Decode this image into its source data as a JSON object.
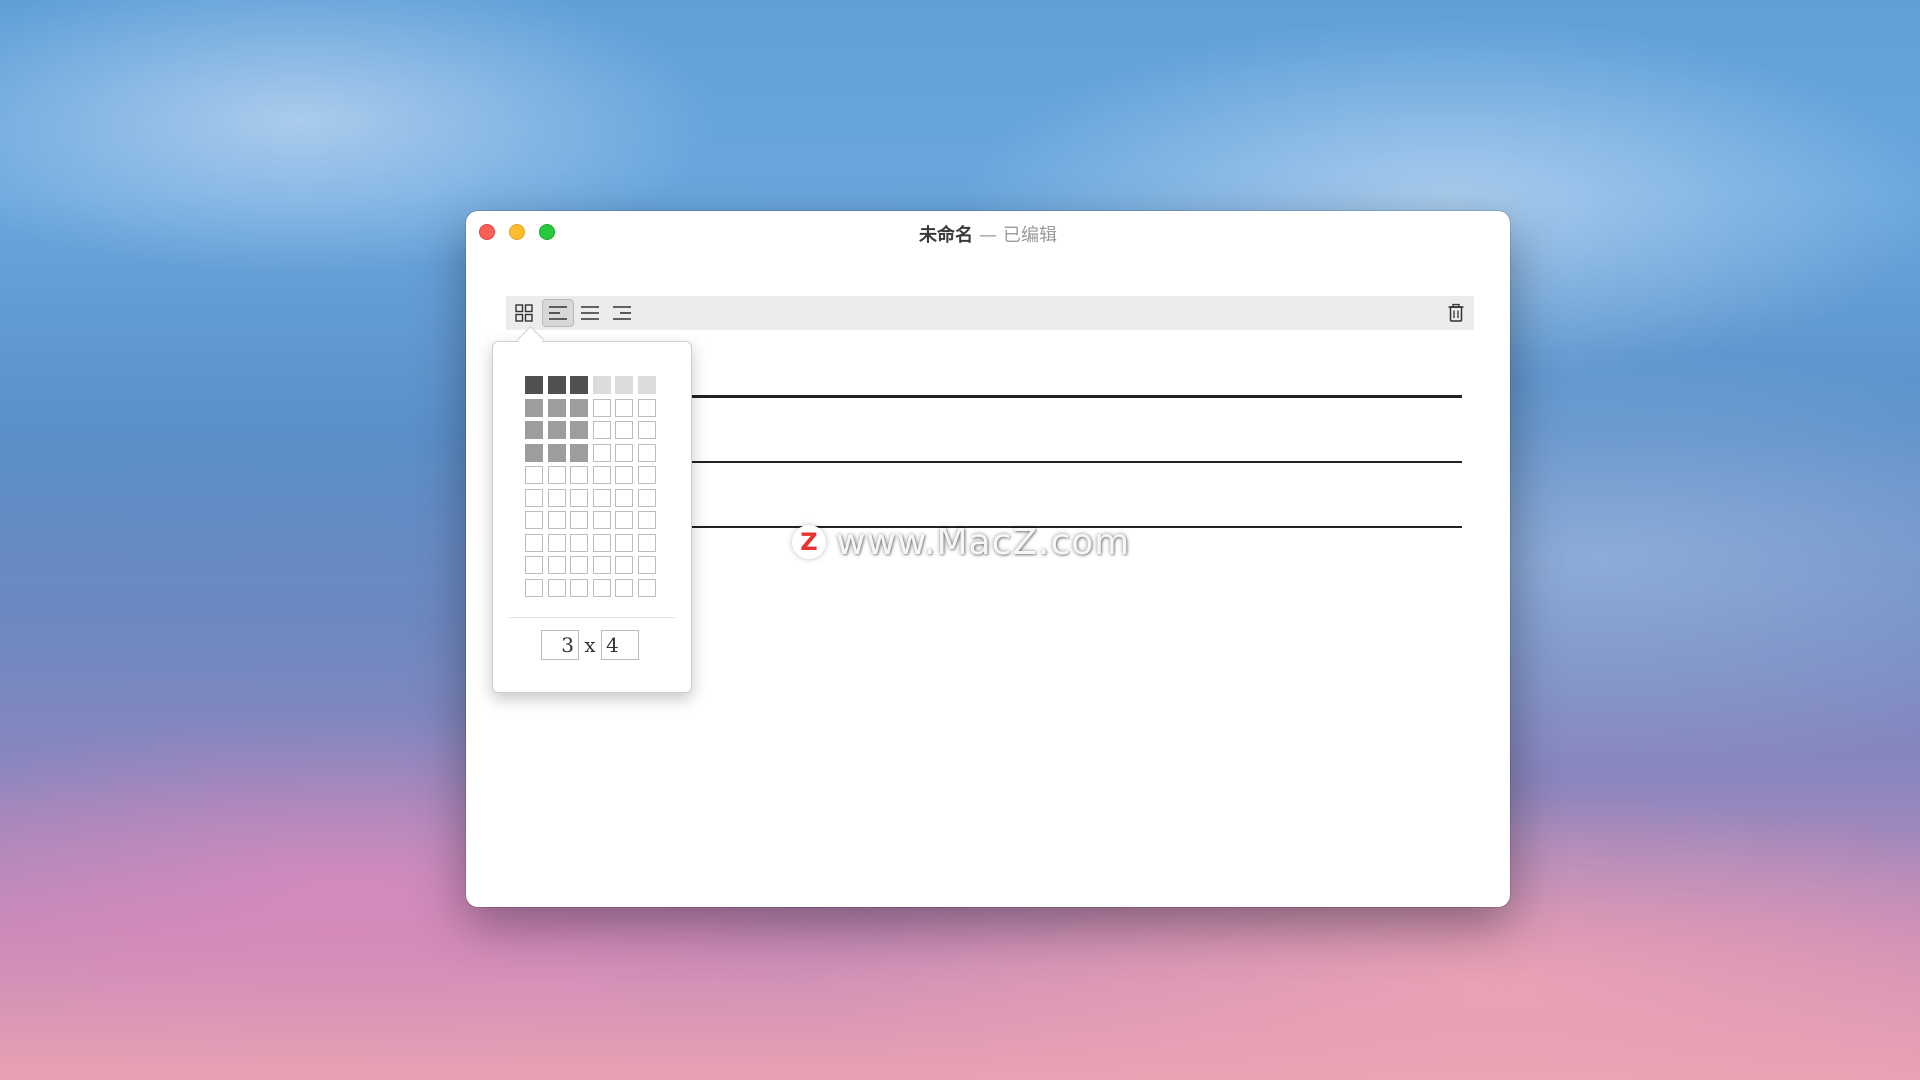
{
  "window": {
    "title_name": "未命名",
    "title_separator": "—",
    "title_status": "已编辑"
  },
  "toolbar": {
    "buttons": [
      {
        "name": "table-grid",
        "icon": "grid-icon",
        "active": false
      },
      {
        "name": "align-left",
        "icon": "align-left-icon",
        "active": true
      },
      {
        "name": "align-justify",
        "icon": "align-justify-icon",
        "active": false
      },
      {
        "name": "align-right",
        "icon": "align-right-icon",
        "active": false
      },
      {
        "name": "delete",
        "icon": "trash-icon",
        "active": false
      }
    ]
  },
  "table_picker": {
    "columns": 6,
    "rows": 10,
    "highlight_cols": 3,
    "highlight_rows": 4,
    "rows_value": "3",
    "multiply_symbol": "x",
    "cols_value": "4"
  },
  "watermark": {
    "badge": "Z",
    "text": "www.MacZ.com"
  },
  "colors": {
    "close": "#fe5f57",
    "minimize": "#febc2e",
    "maximize": "#28c840",
    "toolbar_bg": "#ececec",
    "cell_dark": "#505050",
    "cell_mid": "#9d9d9d",
    "cell_light": "#dcdcdc"
  }
}
